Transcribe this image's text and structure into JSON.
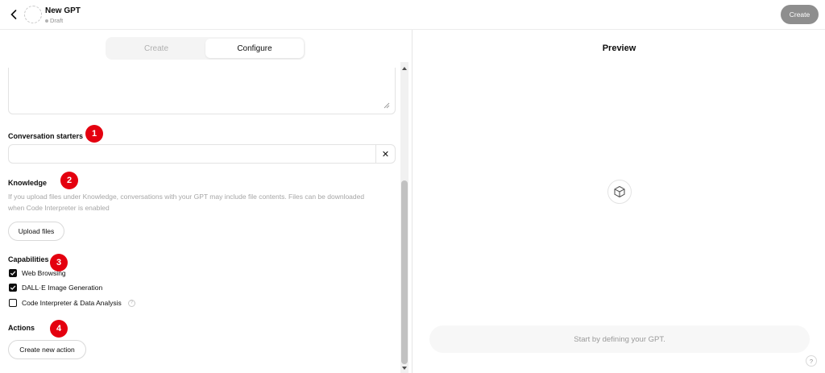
{
  "header": {
    "title": "New GPT",
    "status": "Draft",
    "create_label": "Create"
  },
  "tabs": [
    {
      "label": "Create",
      "active": false
    },
    {
      "label": "Configure",
      "active": true
    }
  ],
  "sections": {
    "conversation_starters": {
      "label": "Conversation starters",
      "value": "",
      "clear_symbol": "✕"
    },
    "knowledge": {
      "label": "Knowledge",
      "help": "If you upload files under Knowledge, conversations with your GPT may include file contents. Files can be downloaded when Code Interpreter is enabled",
      "upload_label": "Upload files"
    },
    "capabilities": {
      "label": "Capabilities",
      "items": [
        {
          "label": "Web Browsing",
          "checked": true
        },
        {
          "label": "DALL·E Image Generation",
          "checked": true
        },
        {
          "label": "Code Interpreter & Data Analysis",
          "checked": false
        }
      ],
      "info_symbol": "?"
    },
    "actions": {
      "label": "Actions",
      "button_label": "Create new action"
    }
  },
  "annotations": [
    "1",
    "2",
    "3",
    "4"
  ],
  "preview": {
    "title": "Preview",
    "placeholder": "Start by defining your GPT.",
    "help_symbol": "?"
  },
  "colors": {
    "badge": "#e4000f",
    "header_button": "#8e8e8e"
  }
}
